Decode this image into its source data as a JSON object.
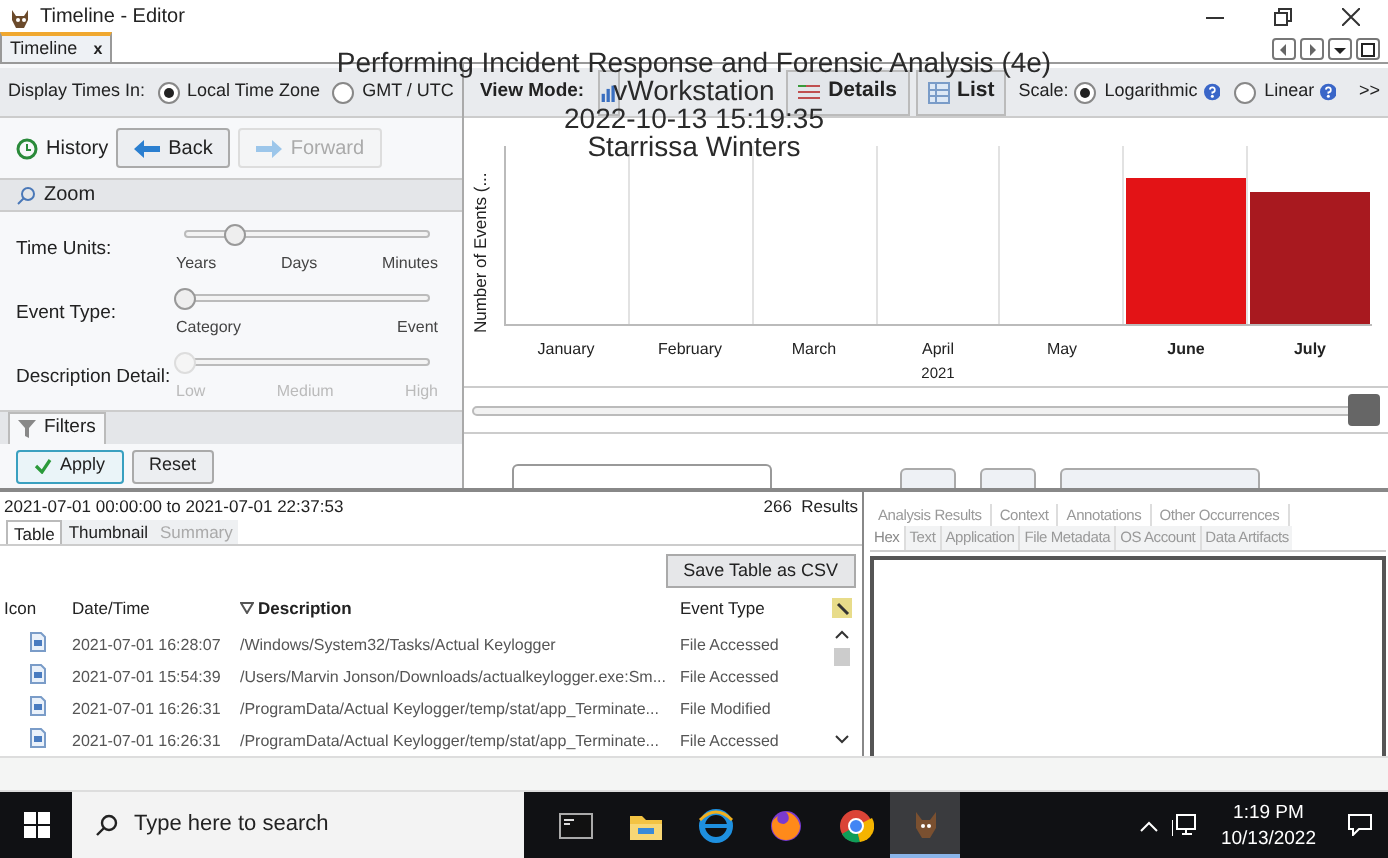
{
  "window": {
    "title": "Timeline - Editor"
  },
  "tab": {
    "label": "Timeline",
    "close": "x"
  },
  "overlay": [
    "Performing Incident Response and Forensic Analysis (4e)",
    "vWorkstation",
    "2022-10-13 15:19:35",
    "Starrissa Winters"
  ],
  "display_times": {
    "label": "Display Times In:",
    "options": [
      {
        "label": "Local Time Zone",
        "selected": true
      },
      {
        "label": "GMT / UTC",
        "selected": false
      }
    ]
  },
  "history": {
    "label": "History",
    "buttons": [
      {
        "label": "Back",
        "disabled": false
      },
      {
        "label": "Forward",
        "disabled": true
      }
    ]
  },
  "zoom": {
    "title": "Zoom",
    "sliders": [
      {
        "label": "Time Units:",
        "level": 0.2,
        "ticks": [
          "Years",
          "Days",
          "Minutes"
        ],
        "disabled": false
      },
      {
        "label": "Event Type:",
        "level": 0,
        "ticks": [
          "Category",
          "Event"
        ],
        "disabled": false
      },
      {
        "label": "Description Detail:",
        "level": 0,
        "ticks": [
          "Low",
          "Medium",
          "High"
        ],
        "disabled": true
      }
    ]
  },
  "filters": {
    "tab": "Filters",
    "buttons": [
      "Apply",
      "Reset"
    ]
  },
  "view_mode": {
    "label": "View Mode:",
    "modes": [
      {
        "kind": "counts"
      },
      {
        "kind": "details",
        "label": "Details"
      },
      {
        "kind": "list",
        "label": "List"
      }
    ]
  },
  "scale": {
    "label": "Scale:",
    "options": [
      {
        "label": "Logarithmic",
        "selected": true
      },
      {
        "label": "Linear",
        "selected": false
      }
    ],
    "more": ">>"
  },
  "chart": {
    "ylabel": "Number of Events (...",
    "year": "2021",
    "months": [
      {
        "label": "January",
        "bold": false
      },
      {
        "label": "February",
        "bold": false
      },
      {
        "label": "March",
        "bold": false
      },
      {
        "label": "April",
        "bold": false
      },
      {
        "label": "May",
        "bold": false
      },
      {
        "label": "June",
        "bold": true,
        "color": "#e31316"
      },
      {
        "label": "July",
        "bold": true,
        "color": "#a8191f"
      }
    ]
  },
  "results": {
    "range": "2021-07-01 00:00:00 to 2021-07-01 22:37:53",
    "count": "266  Results",
    "tabs": [
      {
        "label": "Table",
        "selected": true,
        "disabled": false
      },
      {
        "label": "Thumbnail",
        "selected": false,
        "disabled": false
      },
      {
        "label": "Summary",
        "selected": false,
        "disabled": true
      }
    ],
    "save": "Save Table as CSV",
    "columns": [
      "Icon",
      "Date/Time",
      "Description",
      "Event Type"
    ],
    "rows": [
      {
        "date": "2021-07-01 16:28:07",
        "description": "/Windows/System32/Tasks/Actual Keylogger",
        "event_type": "File Accessed"
      },
      {
        "date": "2021-07-01 15:54:39",
        "description": "/Users/Marvin Jonson/Downloads/actualkeylogger.exe:Sm...",
        "event_type": "File Accessed"
      },
      {
        "date": "2021-07-01 16:26:31",
        "description": "/ProgramData/Actual Keylogger/temp/stat/app_Terminate...",
        "event_type": "File Modified"
      },
      {
        "date": "2021-07-01 16:26:31",
        "description": "/ProgramData/Actual Keylogger/temp/stat/app_Terminate...",
        "event_type": "File Accessed"
      }
    ]
  },
  "content_viewer": {
    "tabs_top": [
      "Analysis Results",
      "Context",
      "Annotations",
      "Other Occurrences"
    ],
    "tabs_bottom": [
      {
        "label": "Hex",
        "selected": true
      },
      {
        "label": "Text",
        "selected": false
      },
      {
        "label": "Application",
        "selected": false
      },
      {
        "label": "File Metadata",
        "selected": false
      },
      {
        "label": "OS Account",
        "selected": false
      },
      {
        "label": "Data Artifacts",
        "selected": false
      }
    ]
  },
  "taskbar": {
    "search_placeholder": "Type here to search",
    "time": "1:19 PM",
    "date": "10/13/2022",
    "apps": [
      {
        "kind": "terminal",
        "active": false
      },
      {
        "kind": "folder",
        "active": false
      },
      {
        "kind": "edge",
        "active": false
      },
      {
        "kind": "firefox",
        "active": false
      },
      {
        "kind": "chrome",
        "active": false
      },
      {
        "kind": "dog",
        "active": true
      }
    ]
  }
}
